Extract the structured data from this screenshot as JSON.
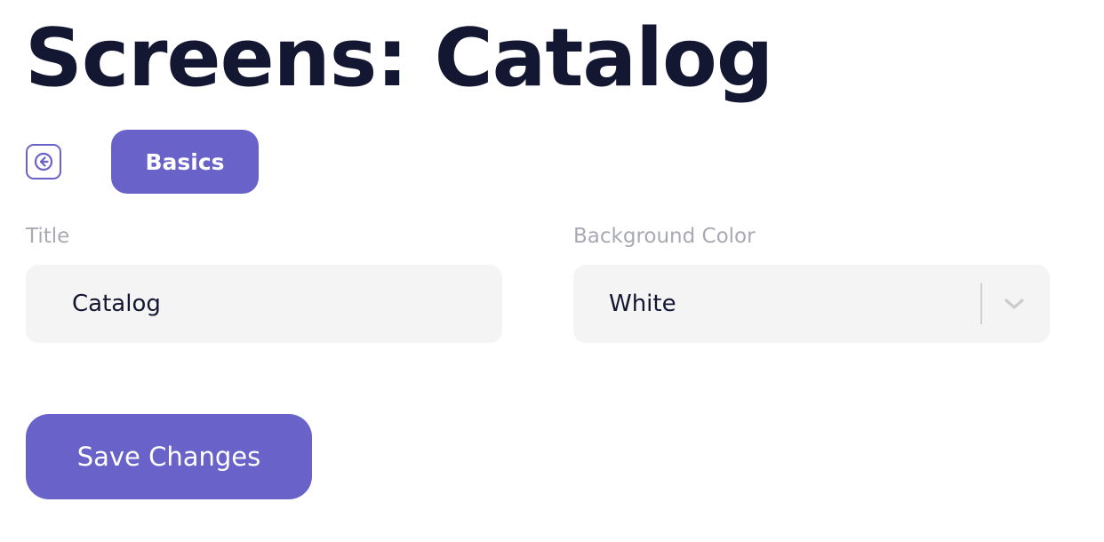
{
  "page": {
    "title": "Screens: Catalog"
  },
  "nav": {
    "back_icon": "arrow-left-icon",
    "tabs": [
      {
        "label": "Basics",
        "active": true
      }
    ]
  },
  "form": {
    "title_field": {
      "label": "Title",
      "value": "Catalog"
    },
    "background_color_field": {
      "label": "Background Color",
      "selected": "White",
      "dropdown_icon": "chevron-down-icon"
    }
  },
  "actions": {
    "save_label": "Save Changes"
  },
  "colors": {
    "accent": "#6962c9",
    "heading": "#141731",
    "label": "#a9a9b4",
    "field_bg": "#f4f4f4"
  }
}
